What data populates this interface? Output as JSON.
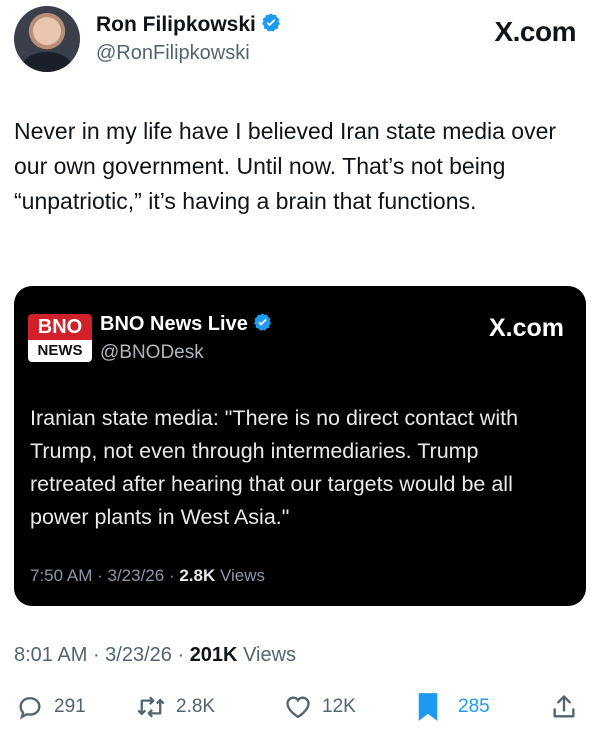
{
  "author": {
    "name": "Ron Filipkowski",
    "handle": "@RonFilipkowski"
  },
  "brand": "X.com",
  "tweet": {
    "text": "Never in my life have I believed Iran state media over our own government. Until now. That’s not being “unpatriotic,” it’s having a brain that functions."
  },
  "quoted": {
    "logo_top": "BNO",
    "logo_bottom": "NEWS",
    "name": "BNO News Live",
    "handle": "@BNODesk",
    "brand": "X.com",
    "text": "Iranian state media: \"There is no direct contact with Trump, not even through intermediaries. Trump retreated after hearing that our targets would be all power plants in West Asia.\"",
    "time": "7:50 AM",
    "date": "3/23/26",
    "views": "2.8K",
    "views_label": "Views"
  },
  "meta": {
    "time": "8:01 AM",
    "date": "3/23/26",
    "views": "201K",
    "views_label": "Views"
  },
  "actions": {
    "replies": "291",
    "reposts": "2.8K",
    "likes": "12K",
    "bookmarks": "285"
  },
  "colors": {
    "verified": "#1d9bf0",
    "bookmark_active": "#1d9bf0",
    "card_bg": "#000000",
    "bno_red": "#d0202a"
  },
  "icons": [
    "verified-badge-icon",
    "reply-icon",
    "repost-icon",
    "like-icon",
    "bookmark-icon",
    "share-icon"
  ]
}
